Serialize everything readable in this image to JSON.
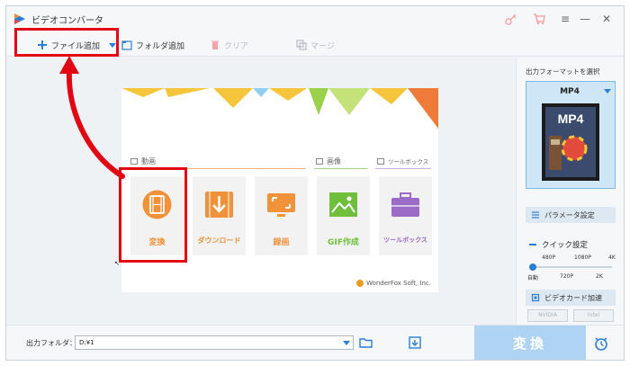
{
  "window": {
    "title": "ビデオコンバータ",
    "icons": [
      "key-icon",
      "cart-icon",
      "menu-icon",
      "minimize-icon",
      "close-icon"
    ]
  },
  "toolbar": {
    "add_file": "ファイル追加",
    "add_folder": "フォルダ追加",
    "clear": "クリア",
    "merge": "マージ"
  },
  "welcome": {
    "sections": {
      "video": "動画",
      "image": "画像",
      "toolbox": "ツールボックス"
    },
    "tiles": [
      {
        "label": "変換",
        "color": "#f0923a",
        "icon": "film-icon"
      },
      {
        "label": "ダウンロード",
        "color": "#f0923a",
        "icon": "download-icon"
      },
      {
        "label": "録画",
        "color": "#f0923a",
        "icon": "screen-record-icon"
      },
      {
        "label": "GIF作成",
        "color": "#6fbf3c",
        "icon": "image-icon"
      },
      {
        "label": "ツールボックス",
        "color": "#9b6cc6",
        "icon": "toolbox-icon"
      }
    ],
    "brand": "WonderFox Soft, Inc."
  },
  "right_panel": {
    "heading": "出力フォーマットを選択",
    "format": "MP4",
    "thumb_text": "MP4",
    "param_button": "パラメータ設定",
    "quick_title": "クイック設定",
    "quick_top": [
      "480P",
      "1080P",
      "4K"
    ],
    "quick_bottom": [
      "自動",
      "720P",
      "2K"
    ],
    "quick_level": 0.0,
    "gpu_button": "ビデオカード加速",
    "chips": [
      "NVIDIA",
      "Intel"
    ]
  },
  "bottom": {
    "output_label": "出力フォルダ：",
    "output_path": "D:¥1",
    "convert": "変換"
  },
  "colors": {
    "accent": "#2a7fd4",
    "highlight": "#e30613",
    "orange": "#f0923a",
    "green": "#6fbf3c",
    "purple": "#9b6cc6"
  }
}
